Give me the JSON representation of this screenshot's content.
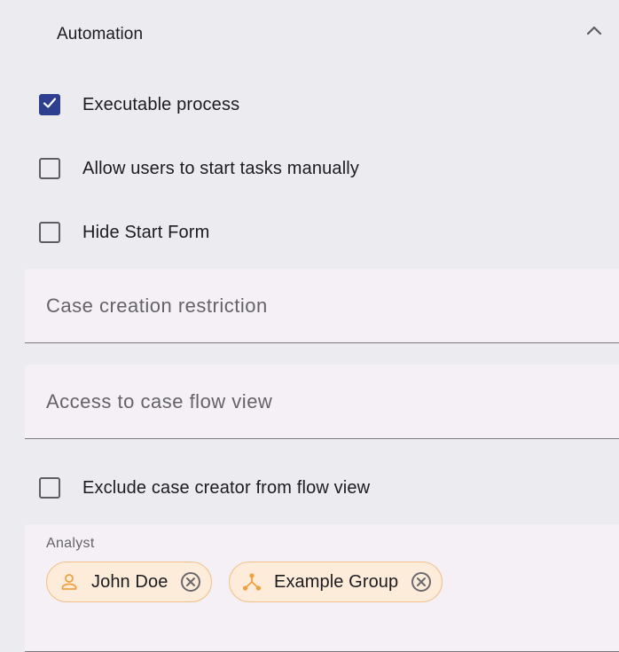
{
  "section": {
    "title": "Automation"
  },
  "options": [
    {
      "label": "Executable process",
      "checked": true
    },
    {
      "label": "Allow users to start tasks manually",
      "checked": false
    },
    {
      "label": "Hide Start Form",
      "checked": false
    }
  ],
  "fields": {
    "case_creation": {
      "label": "Case creation restriction"
    },
    "flow_view_access": {
      "label": "Access to case flow view"
    }
  },
  "exclude_option": {
    "label": "Exclude case creator from flow view",
    "checked": false
  },
  "analyst": {
    "label": "Analyst",
    "chips": [
      {
        "text": "John Doe",
        "icon": "person-icon"
      },
      {
        "text": "Example Group",
        "icon": "group-icon"
      }
    ]
  },
  "colors": {
    "background": "#ECEBEF",
    "field_background": "#F4F0F5",
    "checkbox_checked": "#2f3f8f",
    "chip_background": "#fdecda",
    "chip_border": "#f1c08a",
    "chip_icon": "#f0a040"
  }
}
